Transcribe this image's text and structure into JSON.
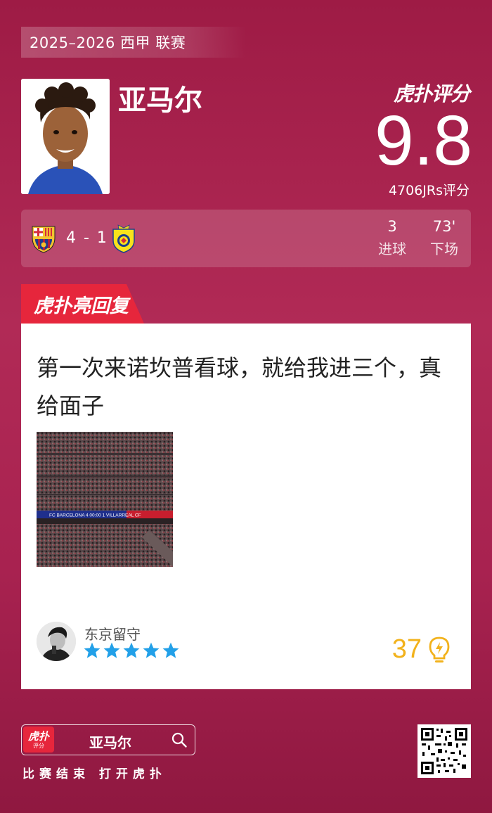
{
  "header": {
    "season": "2025–2026 西甲 联赛",
    "player_name": "亚马尔",
    "rating_brand": "虎扑评分",
    "rating": "9.8",
    "raters": "4706JRs评分"
  },
  "match": {
    "score": "4 - 1",
    "stats": [
      {
        "value": "3",
        "label": "进球"
      },
      {
        "value": "73'",
        "label": "下场"
      }
    ]
  },
  "highlight": {
    "tag": "虎扑亮回复",
    "comment": "第一次来诺坎普看球，就给我进三个，真给面子",
    "user": {
      "name": "东京留守",
      "stars": 5
    },
    "likes": "37"
  },
  "footer": {
    "search_text": "亚马尔",
    "app_icon_big": "虎扑",
    "app_icon_small": "评分",
    "hint": "比赛结束 打开虎扑"
  },
  "colors": {
    "background": "#a82250",
    "accent_red": "#e6263c",
    "star_blue": "#22a0e8",
    "likes_gold": "#f2b21c"
  }
}
